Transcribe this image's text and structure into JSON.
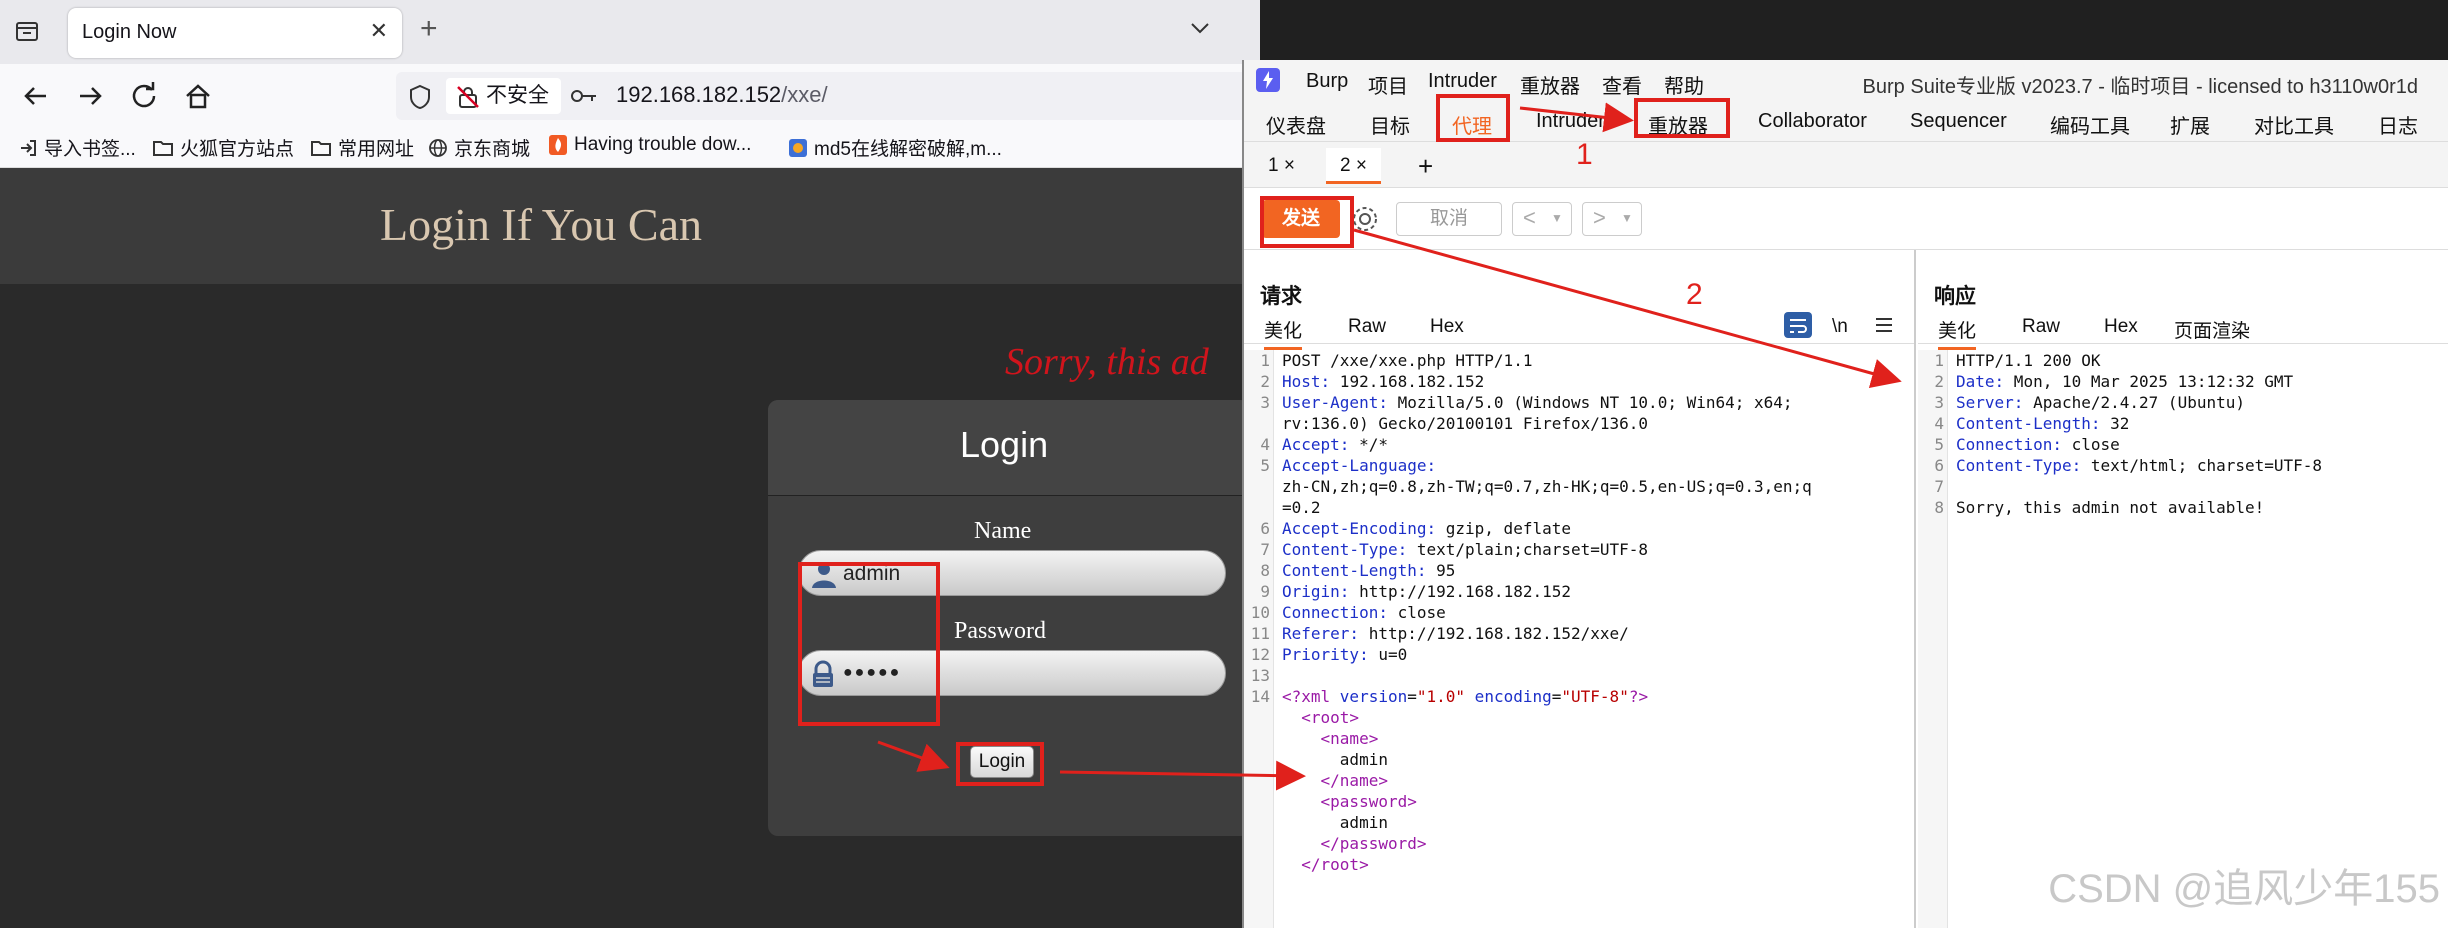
{
  "browser": {
    "tab_title": "Login Now",
    "tab_close": "✕",
    "new_tab": "+",
    "security_label": "不安全",
    "url_host": "192.168.182.152",
    "url_path": "/xxe/",
    "bookmarks": [
      {
        "label": "导入书签..."
      },
      {
        "label": "火狐官方站点"
      },
      {
        "label": "常用网址"
      },
      {
        "label": "京东商城"
      },
      {
        "label": "Having trouble dow..."
      },
      {
        "label": "md5在线解密破解,m..."
      }
    ]
  },
  "page": {
    "title": "Login If You Can",
    "sorry_text": "Sorry, this ad",
    "login_title": "Login",
    "name_label": "Name",
    "name_value": "admin",
    "password_label": "Password",
    "password_value": "●●●●●",
    "login_button": "Login"
  },
  "burp": {
    "menu": [
      "Burp",
      "项目",
      "Intruder",
      "重放器",
      "查看",
      "帮助"
    ],
    "info": "Burp Suite专业版  v2023.7 - 临时项目 - licensed to h3110w0r1d",
    "tabs": [
      "仪表盘",
      "目标",
      "代理",
      "Intruder",
      "重放器",
      "Collaborator",
      "Sequencer",
      "编码工具",
      "扩展",
      "对比工具",
      "日志"
    ],
    "subtabs": [
      "1 ×",
      "2 ×",
      "+"
    ],
    "send_label": "发送",
    "cancel_label": "取消",
    "request": {
      "title": "请求",
      "view_tabs": [
        "美化",
        "Raw",
        "Hex"
      ],
      "newline_icon_label": "\\n",
      "lines": [
        {
          "n": "1",
          "k": "",
          "v": "POST /xxe/xxe.php HTTP/1.1"
        },
        {
          "n": "2",
          "k": "Host:",
          "v": " 192.168.182.152"
        },
        {
          "n": "3",
          "k": "User-Agent:",
          "v": " Mozilla/5.0 (Windows NT 10.0; Win64; x64;"
        },
        {
          "n": "",
          "k": "",
          "v": "rv:136.0) Gecko/20100101 Firefox/136.0"
        },
        {
          "n": "4",
          "k": "Accept:",
          "v": " */*"
        },
        {
          "n": "5",
          "k": "Accept-Language:",
          "v": ""
        },
        {
          "n": "",
          "k": "",
          "v": "zh-CN,zh;q=0.8,zh-TW;q=0.7,zh-HK;q=0.5,en-US;q=0.3,en;q"
        },
        {
          "n": "",
          "k": "",
          "v": "=0.2"
        },
        {
          "n": "6",
          "k": "Accept-Encoding:",
          "v": " gzip, deflate"
        },
        {
          "n": "7",
          "k": "Content-Type:",
          "v": " text/plain;charset=UTF-8"
        },
        {
          "n": "8",
          "k": "Content-Length:",
          "v": " 95"
        },
        {
          "n": "9",
          "k": "Origin:",
          "v": " http://192.168.182.152"
        },
        {
          "n": "10",
          "k": "Connection:",
          "v": " close"
        },
        {
          "n": "11",
          "k": "Referer:",
          "v": " http://192.168.182.152/xxe/"
        },
        {
          "n": "12",
          "k": "Priority:",
          "v": " u=0"
        },
        {
          "n": "13",
          "k": "",
          "v": ""
        }
      ],
      "xml_line_no": "14",
      "xml_decl": {
        "open": "<?xml ",
        "a1": "version",
        "v1": "\"1.0\"",
        "a2": " encoding",
        "v2": "\"UTF-8\"",
        "close": "?>"
      },
      "xml": [
        {
          "indent": "  ",
          "text": "<root>",
          "kind": "tag"
        },
        {
          "indent": "    ",
          "text": "<name>",
          "kind": "tag"
        },
        {
          "indent": "      ",
          "text": "admin",
          "kind": "text"
        },
        {
          "indent": "    ",
          "text": "</name>",
          "kind": "tag"
        },
        {
          "indent": "    ",
          "text": "<password>",
          "kind": "tag"
        },
        {
          "indent": "      ",
          "text": "admin",
          "kind": "text"
        },
        {
          "indent": "    ",
          "text": "</password>",
          "kind": "tag"
        },
        {
          "indent": "  ",
          "text": "</root>",
          "kind": "tag"
        }
      ]
    },
    "response": {
      "title": "响应",
      "view_tabs": [
        "美化",
        "Raw",
        "Hex",
        "页面渲染"
      ],
      "lines": [
        {
          "n": "1",
          "k": "",
          "v": "HTTP/1.1 200 OK"
        },
        {
          "n": "2",
          "k": "Date:",
          "v": " Mon, 10 Mar 2025 13:12:32 GMT"
        },
        {
          "n": "3",
          "k": "Server:",
          "v": " Apache/2.4.27 (Ubuntu)"
        },
        {
          "n": "4",
          "k": "Content-Length:",
          "v": " 32"
        },
        {
          "n": "5",
          "k": "Connection:",
          "v": " close"
        },
        {
          "n": "6",
          "k": "Content-Type:",
          "v": " text/html; charset=UTF-8"
        },
        {
          "n": "7",
          "k": "",
          "v": ""
        },
        {
          "n": "8",
          "k": "",
          "v": "Sorry, this admin not available!"
        }
      ]
    }
  },
  "annotations": {
    "step1": "1",
    "step2": "2",
    "color": "#e0211c"
  },
  "watermark": "CSDN @追风少年155"
}
